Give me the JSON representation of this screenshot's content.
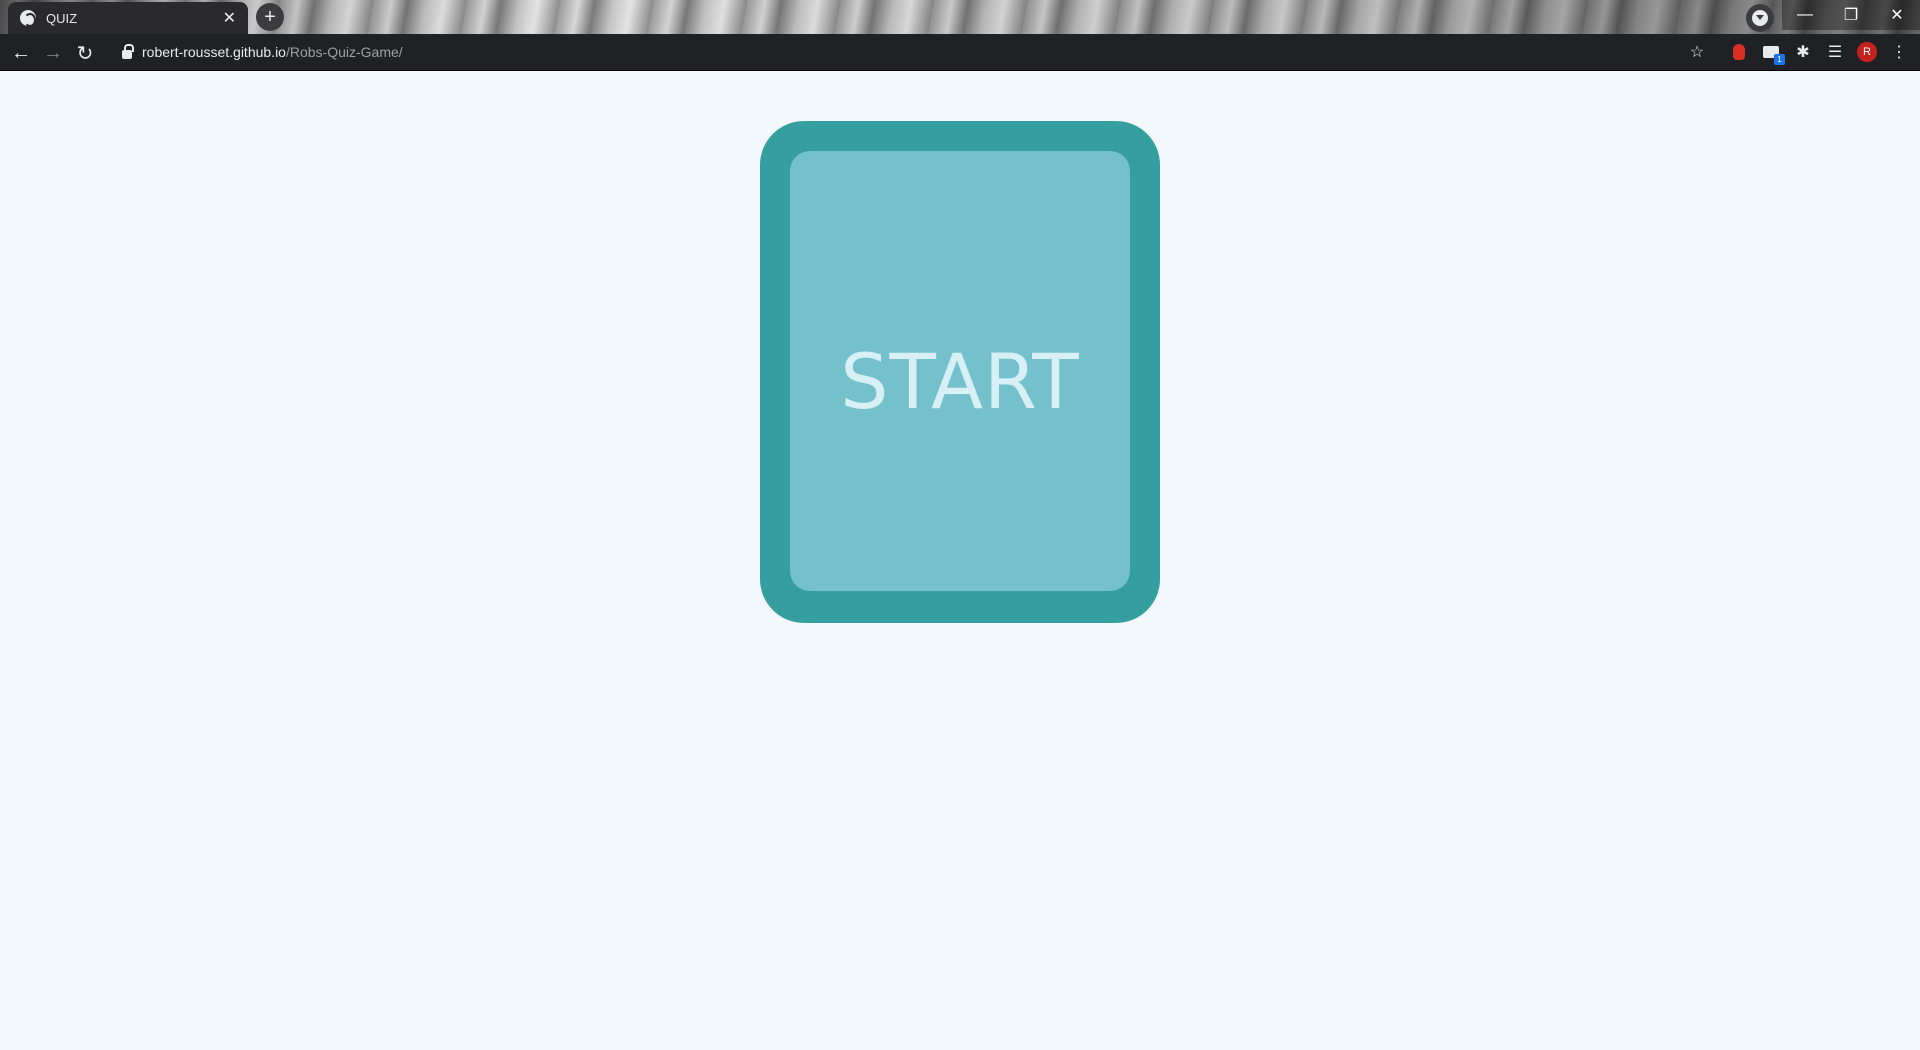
{
  "browser": {
    "tab": {
      "title": "QUIZ",
      "close_glyph": "✕",
      "favicon": "globe-icon"
    },
    "new_tab_glyph": "+",
    "window_controls": {
      "minimize": "—",
      "restore": "❐",
      "close": "✕"
    },
    "nav": {
      "back": "←",
      "forward": "→",
      "reload": "↻"
    },
    "url": {
      "host": "robert-rousset.github.io",
      "path": "/Robs-Quiz-Game/"
    },
    "toolbar_icons": {
      "bookmark": "☆",
      "extensions": "✱",
      "reading_list": "☰",
      "menu": "⋮"
    },
    "profile_initial": "R"
  },
  "page": {
    "start_button_label": "START"
  },
  "colors": {
    "page_background": "#f2f8fd",
    "card_outer": "#349ea0",
    "card_inner": "#74c1cb",
    "label": "#d6f0f5"
  }
}
